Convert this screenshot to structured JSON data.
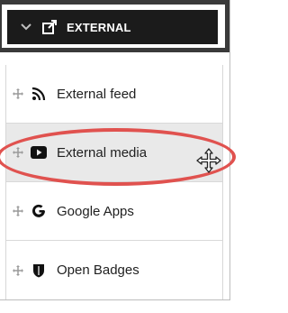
{
  "header": {
    "title": "EXTERNAL",
    "icons": {
      "toggle": "chevron-down-icon",
      "section": "external-link-icon"
    }
  },
  "items": [
    {
      "label": "External feed",
      "icon": "rss-icon"
    },
    {
      "label": "External media",
      "icon": "youtube-icon",
      "highlighted": true
    },
    {
      "label": "Google Apps",
      "icon": "google-icon"
    },
    {
      "label": "Open Badges",
      "icon": "badge-shield-icon"
    }
  ],
  "colors": {
    "header_bg": "#1b1b1b",
    "highlight_ring": "#e0524f",
    "hover_bg": "#e9e9e9"
  },
  "cursor": "move-cursor-icon"
}
